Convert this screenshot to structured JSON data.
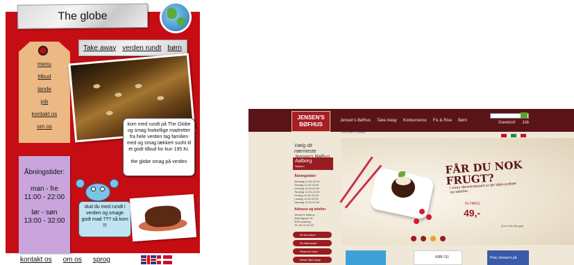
{
  "left_site": {
    "title": "The globe",
    "nav": [
      "Take away",
      "verden rundt",
      "børn"
    ],
    "menu": [
      "menu",
      "tilbud",
      "lande",
      "job",
      "kontakt os",
      "om os"
    ],
    "promo": {
      "text": "kom med rundt på The Globe og smag fookellige madretter fra hele verden tag familien med og smag lækkert sushi til et godt tilbud for kun 195 Kr.",
      "signature": "the globe smag på verden"
    },
    "hours": {
      "title": "Åbningstider:",
      "row1_days": "man - fre",
      "row1_time": "11:00 - 22:00",
      "row2_days": "lør - søn",
      "row2_time": "13:00 - 32:00"
    },
    "bubble": "skal du med rundt i verden og smage godt mad ??? så kom !!!",
    "footer": [
      "kontakt os",
      "om os",
      "sprog"
    ]
  },
  "right_site": {
    "logo": "JENSEN'S BØFHUS",
    "nav": [
      "Jensen's Bøfhus",
      "Take Away",
      "Konkurrence",
      "Fis & Rise",
      "Børn"
    ],
    "cart_nav": [
      "Gavekort",
      "Job"
    ],
    "breadcrumb": "Du er her > Forside",
    "sidebar_title": "Vælg dit nærmeste Jensen's Bøfhus",
    "selected_location": "Aalborg",
    "selected_sub": "Nyhavn",
    "hours_title": "Åbningstider:",
    "hours_rows": [
      {
        "day": "Mandag",
        "time": "11:00-22:00"
      },
      {
        "day": "Tirsdag",
        "time": "11:00-22:00"
      },
      {
        "day": "Onsdag",
        "time": "11:00-22:00"
      },
      {
        "day": "Torsdag",
        "time": "11:00-22:00"
      },
      {
        "day": "Fredag",
        "time": "11:00-22:00"
      },
      {
        "day": "Lørdag",
        "time": "11:00-22:00"
      },
      {
        "day": "Søndag",
        "time": "11:00-22:00"
      }
    ],
    "address_title": "Adresse og telefon",
    "address_lines": [
      "Jensen's Bøfhus",
      "Østerågade 16",
      "9000 Aalborg",
      "Tlf. 98 16 03 33"
    ],
    "buttons": [
      "Se Menukort",
      "Se Nærmeste",
      "Reserver bord",
      "Bestil Take Away"
    ],
    "hero_heading": "FÅR DU NOK FRUGT?",
    "hero_sub": "I vores såmmerdessert er der både jordbær og rabarber.",
    "hero_price_label": "IS-TRIFLI",
    "hero_price": "49,-",
    "hero_note": "(Kun hele tilbuget)",
    "cards": [
      "",
      "KØB OG",
      "Prøv Jensen's på"
    ]
  }
}
